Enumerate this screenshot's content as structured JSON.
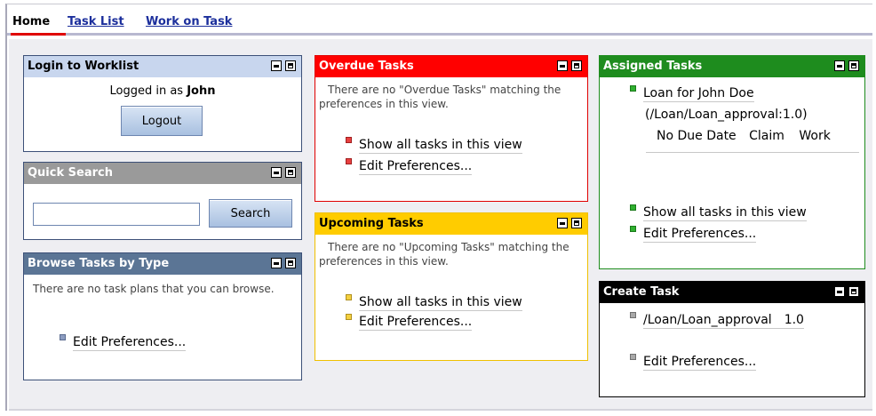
{
  "nav": {
    "tabs": [
      "Home",
      "Task List",
      "Work on Task"
    ]
  },
  "login": {
    "title": "Login to Worklist",
    "logged_in_prefix": "Logged in as",
    "user": "John",
    "logout_label": "Logout"
  },
  "quick_search": {
    "title": "Quick Search",
    "search_value": "",
    "search_label": "Search"
  },
  "browse": {
    "title": "Browse Tasks by Type",
    "message": "There are no task plans that you can browse.",
    "edit_prefs": "Edit Preferences..."
  },
  "overdue": {
    "title": "Overdue Tasks",
    "message": "There are no \"Overdue Tasks\" matching the preferences in this view.",
    "show_all": "Show all tasks in this view",
    "edit_prefs": "Edit Preferences..."
  },
  "upcoming": {
    "title": "Upcoming Tasks",
    "message": "There are no \"Upcoming Tasks\" matching the preferences in this view.",
    "show_all": "Show all tasks in this view",
    "edit_prefs": "Edit Preferences..."
  },
  "assigned": {
    "title": "Assigned Tasks",
    "task_name": "Loan for John Doe",
    "task_path": "(/Loan/Loan_approval:1.0)",
    "due": "No Due Date",
    "claim": "Claim",
    "work": "Work",
    "show_all": "Show all tasks in this view",
    "edit_prefs": "Edit Preferences..."
  },
  "create": {
    "title": "Create Task",
    "plan": "/Loan/Loan_approval",
    "version": "1.0",
    "edit_prefs": "Edit Preferences..."
  },
  "colors": {
    "login_header": "#c8d6ee",
    "quick_search_header": "#9a9a9a",
    "browse_header": "#5b7595",
    "overdue_header": "#ff0000",
    "upcoming_header": "#ffcc00",
    "assigned_header": "#1e8c1e",
    "create_header": "#000000"
  }
}
